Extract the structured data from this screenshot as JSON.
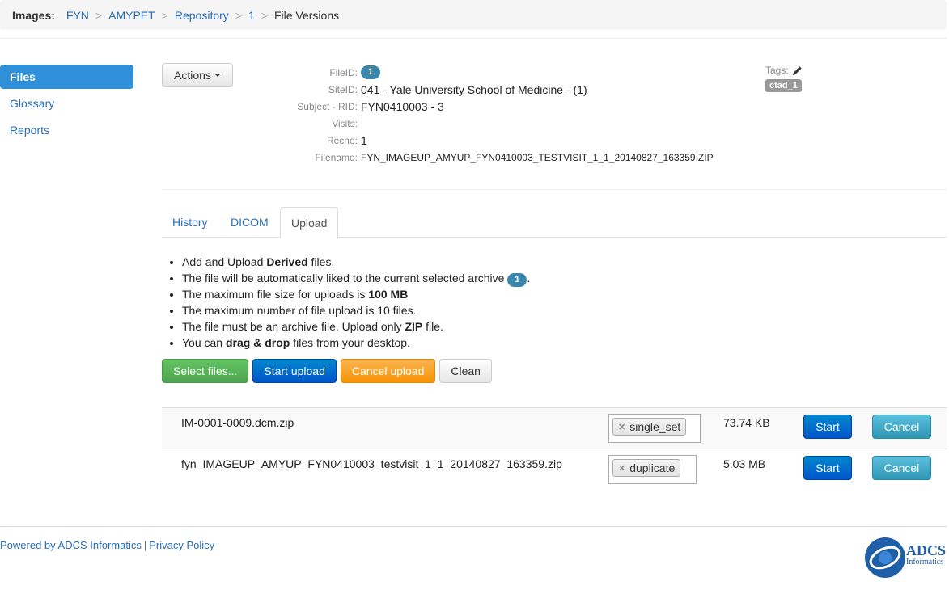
{
  "breadcrumb": {
    "label": "Images:",
    "items": [
      "FYN",
      "AMYPET",
      "Repository",
      "1"
    ],
    "separator": ">",
    "current": "File Versions"
  },
  "sidebar": {
    "items": [
      {
        "label": "Files",
        "active": true
      },
      {
        "label": "Glossary",
        "active": false
      },
      {
        "label": "Reports",
        "active": false
      }
    ]
  },
  "actions": {
    "label": "Actions"
  },
  "details": {
    "file_id_label": "FileID:",
    "file_id": "1",
    "site_id_label": "SiteID:",
    "site_id": "041 - Yale University School of Medicine - (1)",
    "subject_label": "Subject - RID:",
    "subject": "FYN0410003 - 3",
    "visits_label": "Visits:",
    "visits": "",
    "recno_label": "Recno:",
    "recno": "1",
    "filename_label": "Filename:",
    "filename": "FYN_IMAGEUP_AMYUP_FYN0410003_TESTVISIT_1_1_20140827_163359.ZIP"
  },
  "tags": {
    "label": "Tags:",
    "items": [
      "ctad_1"
    ]
  },
  "tabs": [
    {
      "label": "History",
      "active": false
    },
    {
      "label": "DICOM",
      "active": false
    },
    {
      "label": "Upload",
      "active": true
    }
  ],
  "upload_info": {
    "line1_pre": "Add and Upload ",
    "line1_bold": "Derived",
    "line1_post": " files.",
    "line2_pre": "The file will be automatically liked to the current selected archive ",
    "line2_badge": "1",
    "line2_post": ".",
    "line3_pre": "The maximum file size for uploads is ",
    "line3_bold": "100 MB",
    "line4": "The maximum number of file upload is 10 files.",
    "line5_pre": "The file must be an archive file. Upload only ",
    "line5_bold": "ZIP",
    "line5_post": " file.",
    "line6_pre": "You can ",
    "line6_bold": "drag & drop",
    "line6_post": " files from your desktop."
  },
  "upload_buttons": {
    "select": "Select files...",
    "start": "Start upload",
    "cancel": "Cancel upload",
    "clean": "Clean"
  },
  "files": [
    {
      "name": "IM-0001-0009.dcm.zip",
      "tag": "single_set",
      "size": "73.74 KB",
      "start": "Start",
      "cancel": "Cancel"
    },
    {
      "name": "fyn_IMAGEUP_AMYUP_FYN0410003_testvisit_1_1_20140827_163359.zip",
      "tag": "duplicate",
      "size": "5.03 MB",
      "start": "Start",
      "cancel": "Cancel"
    }
  ],
  "footer": {
    "powered": "Powered by ADCS Informatics",
    "separator": "|",
    "privacy": "Privacy Policy"
  },
  "logo": {
    "title": "ADCS",
    "subtitle": "Informatics"
  },
  "colors": {
    "link": "#2a6ebb",
    "active_nav": "#2f8fd8",
    "badge": "#3a87ad",
    "success": "#51a351",
    "primary": "#0055cc",
    "warning": "#f89406",
    "info": "#2f96b4"
  },
  "icons": {
    "edit": "pencil-icon",
    "remove_tag": "remove-tag-icon",
    "caret": "caret-down-icon"
  }
}
